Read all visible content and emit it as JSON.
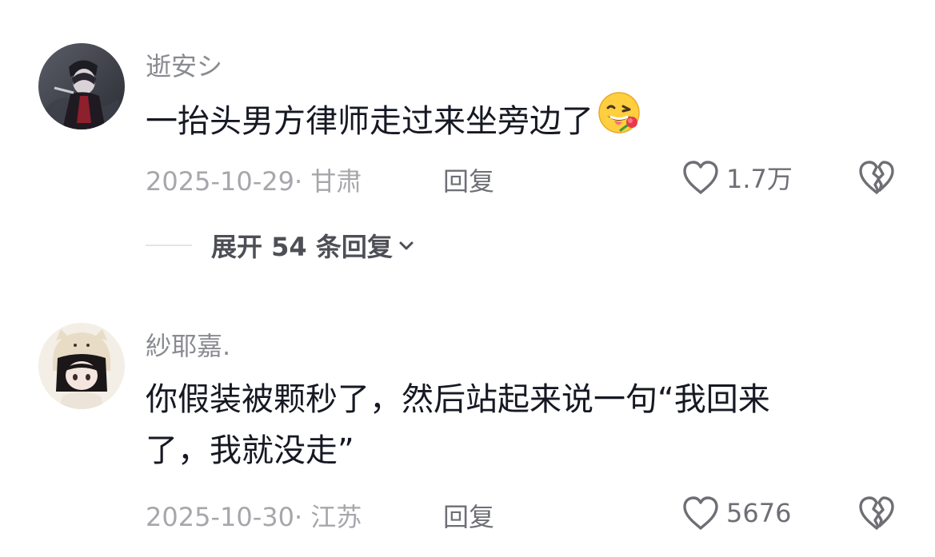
{
  "comments": [
    {
      "username": "逝安シ",
      "text": "一抬头男方律师走过来坐旁边了",
      "emoji": "tongue-rose-face-emoji",
      "date_location": "2025-10-29· 甘肃",
      "reply_label": "回复",
      "like_count": "1.7万",
      "expand_replies_label": "展开 54 条回复"
    },
    {
      "username": "紗耶嘉.",
      "text_line_1": "你假装被颗秒了，然后站起来说一句“我回来",
      "text_line_2": "了，我就没走”",
      "date_location": "2025-10-30· 江苏",
      "reply_label": "回复",
      "like_count": "5676"
    }
  ],
  "colors": {
    "text_primary": "#161823",
    "text_secondary": "#8a8b91",
    "text_meta": "#a6a7ab",
    "icon": "#6e6f75"
  },
  "icons": {
    "like": "heart-outline-icon",
    "dislike": "broken-heart-icon",
    "expand": "chevron-down-icon"
  }
}
